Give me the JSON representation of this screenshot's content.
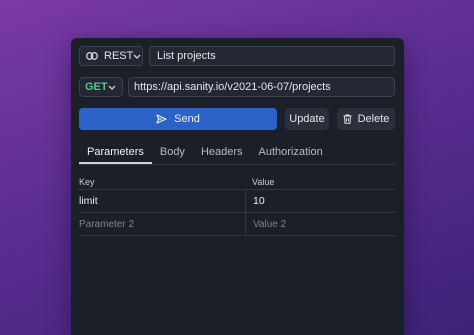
{
  "request": {
    "type_select": {
      "value": "REST",
      "icon": "link-icon"
    },
    "name": "List projects",
    "method": "GET",
    "url": "https://api.sanity.io/v2021-06-07/projects"
  },
  "actions": {
    "send": "Send",
    "update": "Update",
    "delete": "Delete"
  },
  "tabs": [
    "Parameters",
    "Body",
    "Headers",
    "Authorization"
  ],
  "params": {
    "header_key": "Key",
    "header_value": "Value",
    "rows": [
      {
        "key": "limit",
        "value": "10"
      }
    ],
    "placeholder_key": "Parameter 2",
    "placeholder_value": "Value 2"
  },
  "colors": {
    "accent": "#2d63c8",
    "method_get": "#4ec98e",
    "panel": "#1b1f27"
  }
}
